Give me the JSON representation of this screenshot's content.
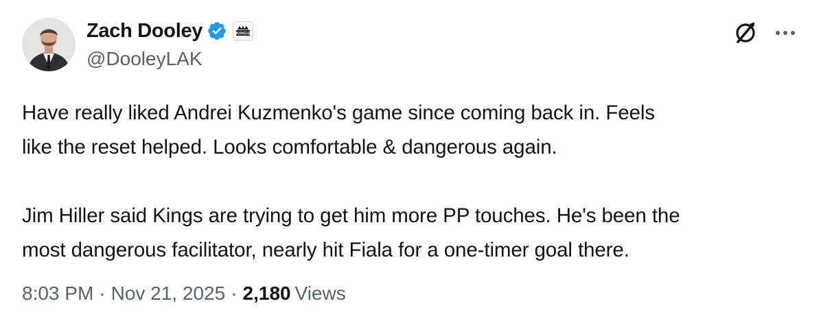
{
  "author": {
    "display_name": "Zach Dooley",
    "handle": "@DooleyLAK",
    "verified_color": "#1d9bf0",
    "affiliate_badge": "kings-logo",
    "affiliate_badge_text": "KINGS"
  },
  "icons": {
    "grok": "grok-icon",
    "more": "more-options-icon",
    "verified": "verified-badge-icon"
  },
  "tweet": {
    "lines": [
      "Have really liked Andrei Kuzmenko's game since coming back in. Feels",
      "like the reset helped. Looks comfortable & dangerous again.",
      "",
      "Jim Hiller said Kings are trying to get him more PP touches. He's been the",
      "most dangerous facilitator, nearly hit Fiala for a one-timer goal there."
    ]
  },
  "meta": {
    "time": "8:03 PM",
    "separator": "·",
    "date": "Nov 21, 2025",
    "views_count": "2,180",
    "views_label": "Views"
  },
  "colors": {
    "text": "#0f1419",
    "secondary": "#536471",
    "accent": "#1d9bf0"
  }
}
